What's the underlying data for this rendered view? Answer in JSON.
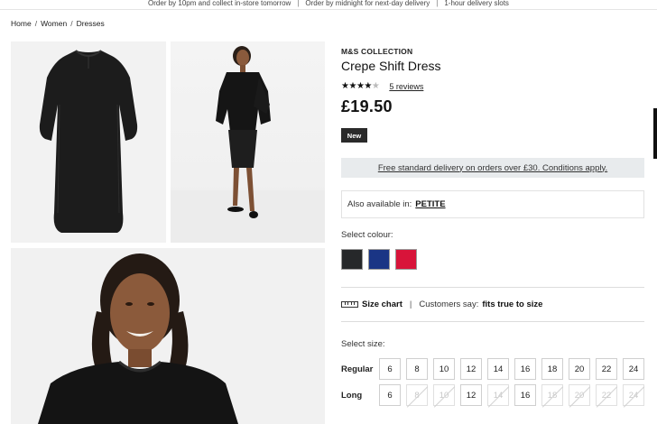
{
  "promo_bar": {
    "items": [
      "Order by 10pm and collect in-store tomorrow",
      "Order by midnight for next-day delivery",
      "1-hour delivery slots"
    ],
    "separator": "|"
  },
  "breadcrumb": {
    "items": [
      "Home",
      "Women",
      "Dresses"
    ],
    "separator": "/"
  },
  "gallery": {
    "images": [
      "dress-flat-front-photo",
      "model-full-length-photo",
      "model-portrait-photo"
    ]
  },
  "product": {
    "brand": "M&S COLLECTION",
    "title": "Crepe Shift Dress",
    "rating": 4,
    "rating_max": 5,
    "reviews_label": "5 reviews",
    "price": "£19.50",
    "badge": "New"
  },
  "delivery_banner": "Free standard delivery on orders over £30. Conditions apply.",
  "availability": {
    "prefix": "Also available in:",
    "link": "PETITE"
  },
  "colour": {
    "label": "Select colour:",
    "swatches": [
      {
        "name": "black",
        "hex": "#26282a"
      },
      {
        "name": "navy",
        "hex": "#1a3585"
      },
      {
        "name": "red",
        "hex": "#d8143a"
      }
    ]
  },
  "size_info": {
    "chart_label": "Size chart",
    "separator": "|",
    "customers_say": "Customers say:",
    "fit_value": "fits true to size"
  },
  "sizes": {
    "label": "Select size:",
    "rows": [
      {
        "label": "Regular",
        "options": [
          {
            "size": "6",
            "available": true
          },
          {
            "size": "8",
            "available": true
          },
          {
            "size": "10",
            "available": true
          },
          {
            "size": "12",
            "available": true
          },
          {
            "size": "14",
            "available": true
          },
          {
            "size": "16",
            "available": true
          },
          {
            "size": "18",
            "available": true
          },
          {
            "size": "20",
            "available": true
          },
          {
            "size": "22",
            "available": true
          },
          {
            "size": "24",
            "available": true
          }
        ]
      },
      {
        "label": "Long",
        "options": [
          {
            "size": "6",
            "available": true
          },
          {
            "size": "8",
            "available": false
          },
          {
            "size": "10",
            "available": false
          },
          {
            "size": "12",
            "available": true
          },
          {
            "size": "14",
            "available": false
          },
          {
            "size": "16",
            "available": true
          },
          {
            "size": "18",
            "available": false
          },
          {
            "size": "20",
            "available": false
          },
          {
            "size": "22",
            "available": false
          },
          {
            "size": "24",
            "available": false
          }
        ]
      }
    ]
  }
}
